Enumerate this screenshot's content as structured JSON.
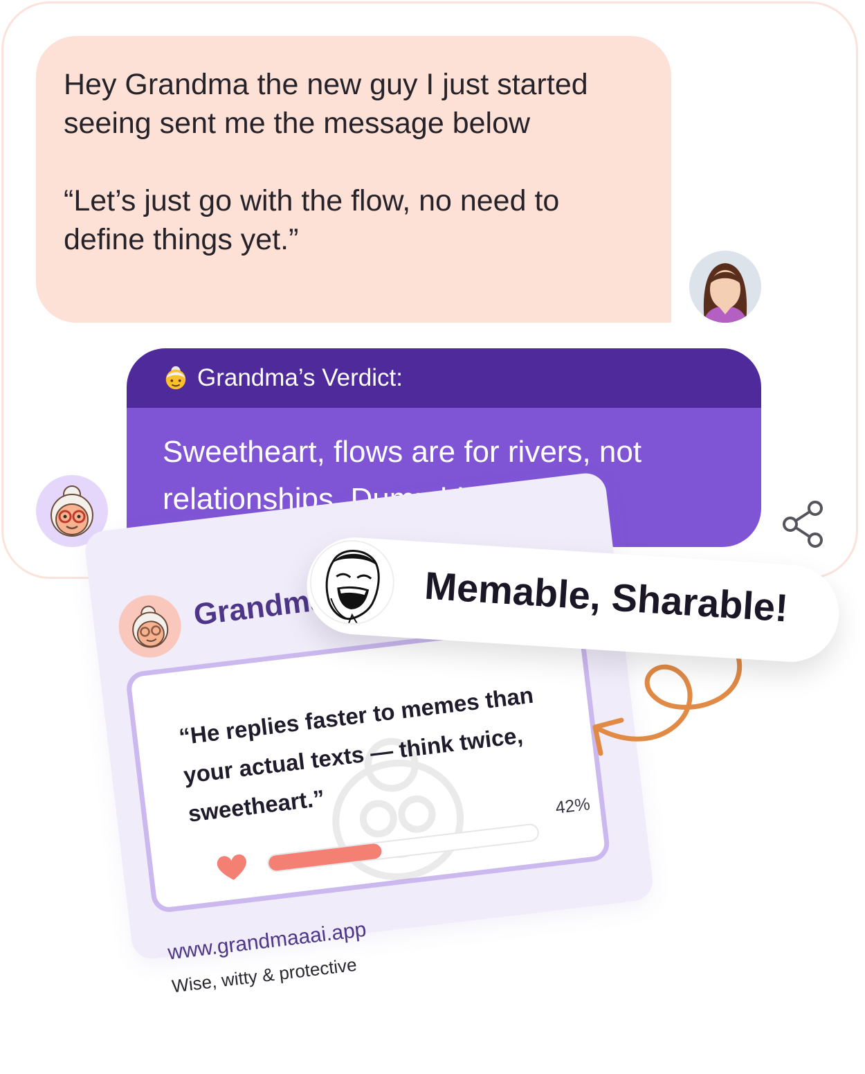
{
  "user_message": {
    "line1": "Hey Grandma the new guy I just started seeing sent me the message below",
    "line2": "“Let’s just go with the flow, no need to define things yet.”"
  },
  "verdict": {
    "header": "Grandma’s Verdict:",
    "text_before_flag": "Sweetheart, flows are for rivers, not relationships. Dump him ",
    "text_after_flag": ".",
    "emoji_icon": "grandma-emoji-icon",
    "flag_icon": "red-flag-icon"
  },
  "share": {
    "icon": "share-icon"
  },
  "card": {
    "title": "Grandma's",
    "quote": "“He replies faster to memes than your actual texts — think twice, sweetheart.”",
    "progress_label": "42%",
    "progress_fraction": 0.42,
    "url": "www.grandmaaai.app",
    "tagline": "Wise, witty & protective"
  },
  "meme_pill": {
    "label": "Memable, Sharable!"
  },
  "colors": {
    "user_bubble": "#fde1d6",
    "verdict_header": "#4f2a9a",
    "verdict_body": "#7f55d6",
    "card_bg": "#f0ecfa",
    "progress_fill": "#f47f73",
    "accent_arrow": "#e08a46"
  }
}
